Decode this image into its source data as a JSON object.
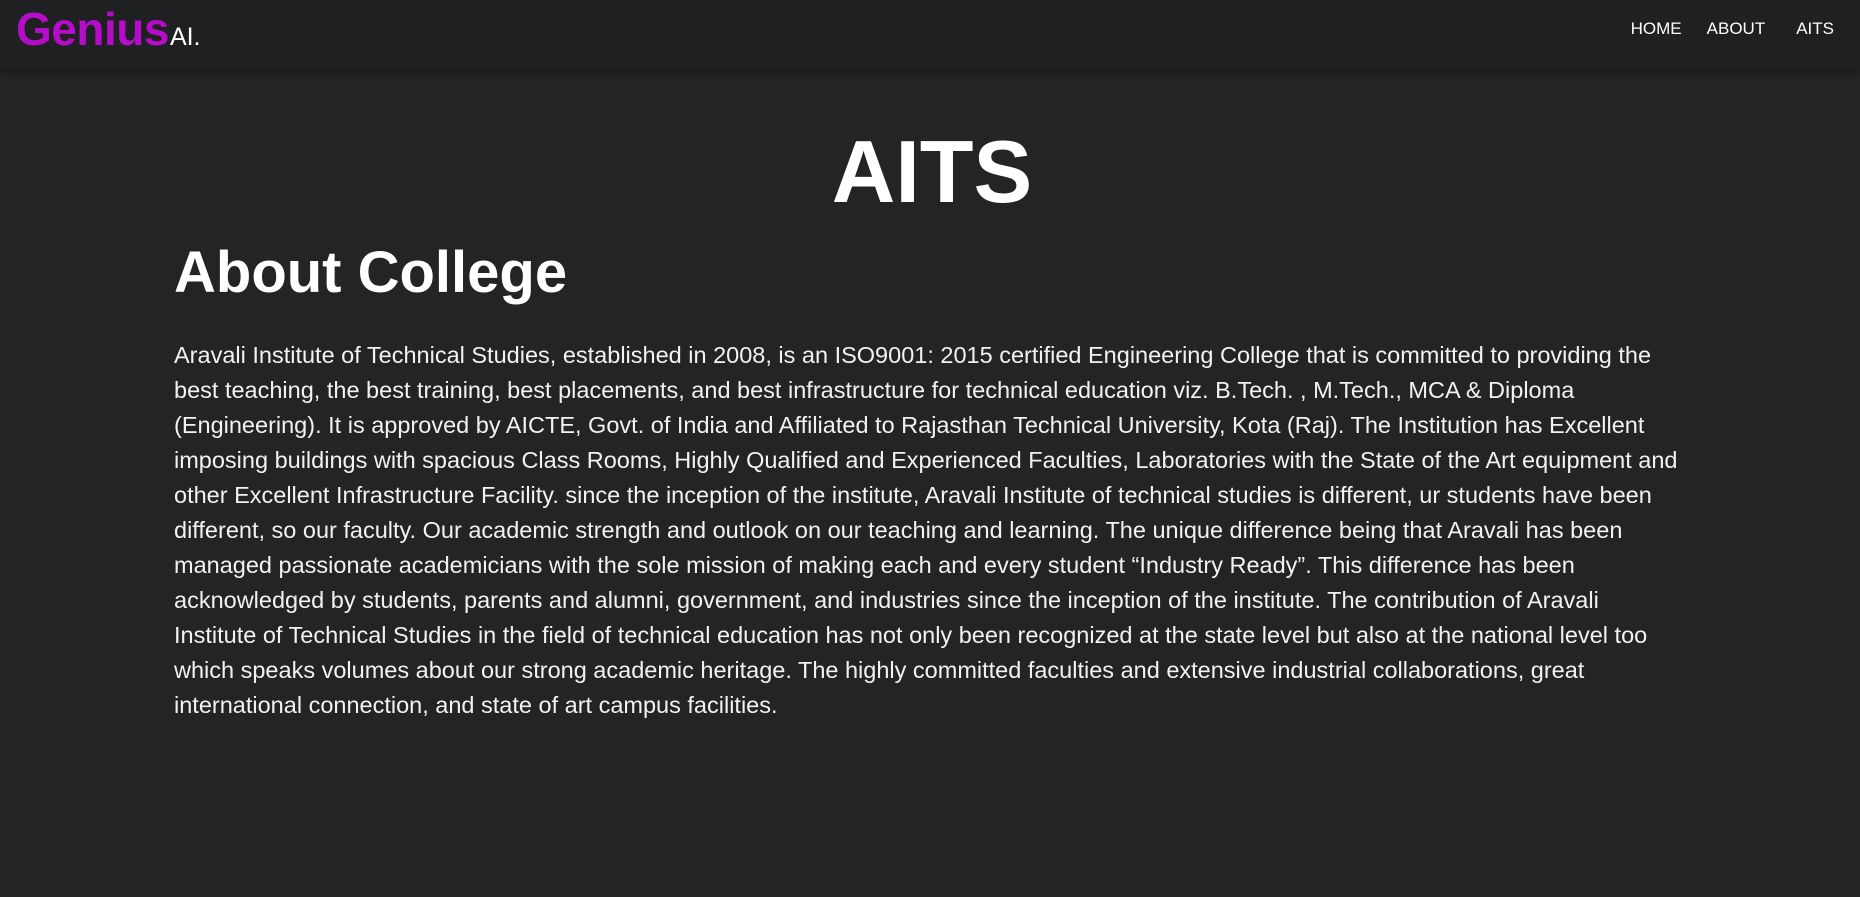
{
  "navbar": {
    "brand_main": "Genius",
    "brand_suffix": "AI.",
    "links": [
      "HOME",
      "ABOUT",
      "AITS"
    ]
  },
  "main": {
    "title": "AITS",
    "section_title": "About College",
    "paragraph": "Aravali Institute of Technical Studies, established in 2008, is an ISO9001: 2015 certified Engineering College that is committed to providing the best teaching, the best training, best placements, and best infrastructure for technical education viz. B.Tech. , M.Tech., MCA & Diploma (Engineering). It is approved by AICTE, Govt. of India and Affiliated to Rajasthan Technical University, Kota (Raj). The Institution has Excellent imposing buildings with spacious Class Rooms, Highly Qualified and Experienced Faculties, Laboratories with the State of the Art equipment and other Excellent Infrastructure Facility. since the inception of the institute, Aravali Institute of technical studies is different, ur students have been different, so our faculty. Our academic strength and outlook on our teaching and learning. The unique difference being that Aravali has been managed passionate academicians with the sole mission of making each and every student “Industry Ready”. This difference has been acknowledged by students, parents and alumni, government, and industries since the inception of the institute. The contribution of Aravali Institute of Technical Studies in the field of technical education has not only been recognized at the state level but also at the national level too which speaks volumes about our strong academic heritage. The highly committed faculties and extensive industrial collaborations, great international connection, and state of art campus facilities."
  },
  "colors": {
    "background": "#242424",
    "navbar_background": "#1f2022",
    "brand_accent": "#b40cc8",
    "text": "#ffffff"
  }
}
